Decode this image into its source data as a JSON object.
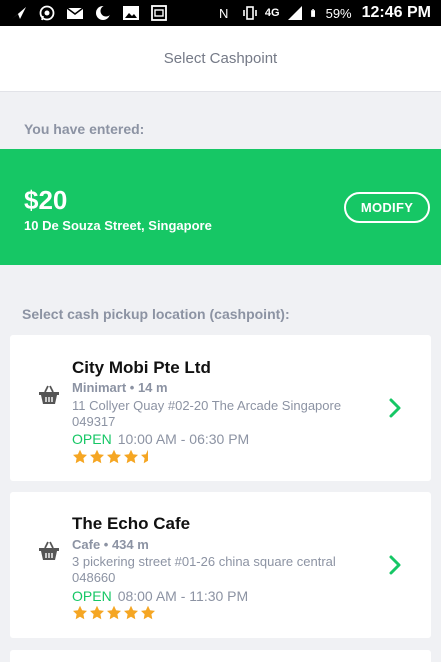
{
  "status_bar": {
    "network": "4G",
    "battery": "59%",
    "time": "12:46 PM",
    "icons": [
      "send-icon",
      "whatsapp-icon",
      "mail-icon",
      "moon-icon",
      "image-icon",
      "screenshot-icon"
    ],
    "right_icons": [
      "nfc-icon",
      "vibrate-icon",
      "signal-icon",
      "battery-icon"
    ]
  },
  "header": {
    "title": "Select Cashpoint"
  },
  "entered": {
    "label": "You have entered:",
    "amount": "$20",
    "address": "10 De Souza Street, Singapore",
    "modify_label": "MODIFY"
  },
  "cashpoints": {
    "label": "Select cash pickup location (cashpoint):",
    "items": [
      {
        "name": "City Mobi Pte Ltd",
        "meta": "Minimart • 14 m",
        "address": "11 Collyer Quay #02-20 The Arcade Singapore 049317",
        "status": "OPEN",
        "hours": "10:00 AM - 06:30 PM",
        "rating": 4.5
      },
      {
        "name": "The Echo Cafe",
        "meta": "Cafe • 434 m",
        "address": " 3 pickering street #01-26 china square central 048660",
        "status": "OPEN",
        "hours": "08:00 AM - 11:30 PM",
        "rating": 5
      }
    ]
  },
  "colors": {
    "accent_green": "#16c765",
    "star": "#f5a623",
    "muted_text": "#8c93a3",
    "background": "#f0f1f4"
  }
}
